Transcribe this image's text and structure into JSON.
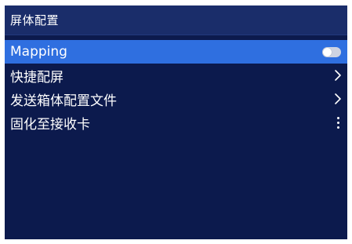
{
  "header": {
    "title": "屏体配置"
  },
  "menu": {
    "items": [
      {
        "label": "Mapping",
        "control": "toggle",
        "toggle_on": false,
        "selected": true
      },
      {
        "label": "快捷配屏",
        "control": "chevron-right-icon"
      },
      {
        "label": "发送箱体配置文件",
        "control": "chevron-right-icon"
      },
      {
        "label": "固化至接收卡",
        "control": "more-vertical-icon"
      }
    ]
  },
  "colors": {
    "background": "#0c1a4d",
    "titlebar": "#1a2d6a",
    "selected_row": "#2f6fe0",
    "text": "#ffffff",
    "toggle_track": "#cdd3e2"
  }
}
